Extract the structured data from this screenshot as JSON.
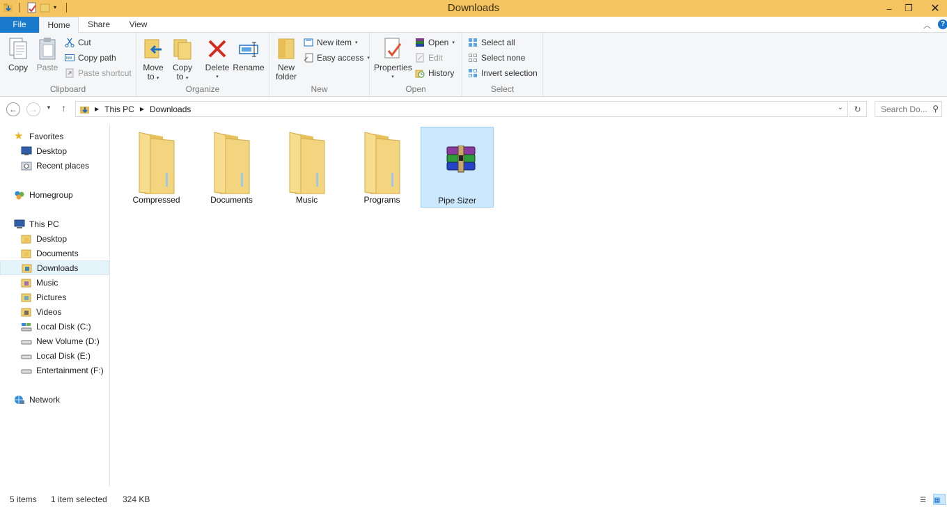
{
  "window": {
    "title": "Downloads",
    "minimize": "–",
    "maximize": "❐",
    "close": "✕"
  },
  "ribbon_tabs": {
    "file": "File",
    "home": "Home",
    "share": "Share",
    "view": "View"
  },
  "ribbon": {
    "clipboard": {
      "label": "Clipboard",
      "copy": "Copy",
      "paste": "Paste",
      "cut": "Cut",
      "copy_path": "Copy path",
      "paste_shortcut": "Paste shortcut"
    },
    "organize": {
      "label": "Organize",
      "move_to_1": "Move",
      "move_to_2": "to",
      "copy_to_1": "Copy",
      "copy_to_2": "to",
      "delete": "Delete",
      "rename": "Rename"
    },
    "new": {
      "label": "New",
      "new_folder_1": "New",
      "new_folder_2": "folder",
      "new_item": "New item",
      "easy_access": "Easy access"
    },
    "open": {
      "label": "Open",
      "properties": "Properties",
      "open": "Open",
      "edit": "Edit",
      "history": "History"
    },
    "select": {
      "label": "Select",
      "select_all": "Select all",
      "select_none": "Select none",
      "invert_selection": "Invert selection"
    }
  },
  "address": {
    "crumbs": [
      "This PC",
      "Downloads"
    ],
    "search_placeholder": "Search Do..."
  },
  "nav": {
    "favorites": "Favorites",
    "desktop_fav": "Desktop",
    "recent": "Recent places",
    "homegroup": "Homegroup",
    "this_pc": "This PC",
    "pc_items": [
      "Desktop",
      "Documents",
      "Downloads",
      "Music",
      "Pictures",
      "Videos",
      "Local Disk (C:)",
      "New Volume (D:)",
      "Local Disk (E:)",
      "Entertainment (F:)"
    ],
    "network": "Network"
  },
  "files": [
    {
      "name": "Compressed",
      "type": "folder"
    },
    {
      "name": "Documents",
      "type": "folder"
    },
    {
      "name": "Music",
      "type": "folder"
    },
    {
      "name": "Programs",
      "type": "folder"
    },
    {
      "name": "Pipe Sizer",
      "type": "winrar-archive",
      "selected": true
    }
  ],
  "status": {
    "count": "5 items",
    "selected": "1 item selected",
    "size": "324 KB"
  },
  "colors": {
    "titlebar": "#f3c460",
    "file_tab": "#1979ca",
    "selection": "#cce8ff",
    "folder": "#f0cf6e"
  }
}
